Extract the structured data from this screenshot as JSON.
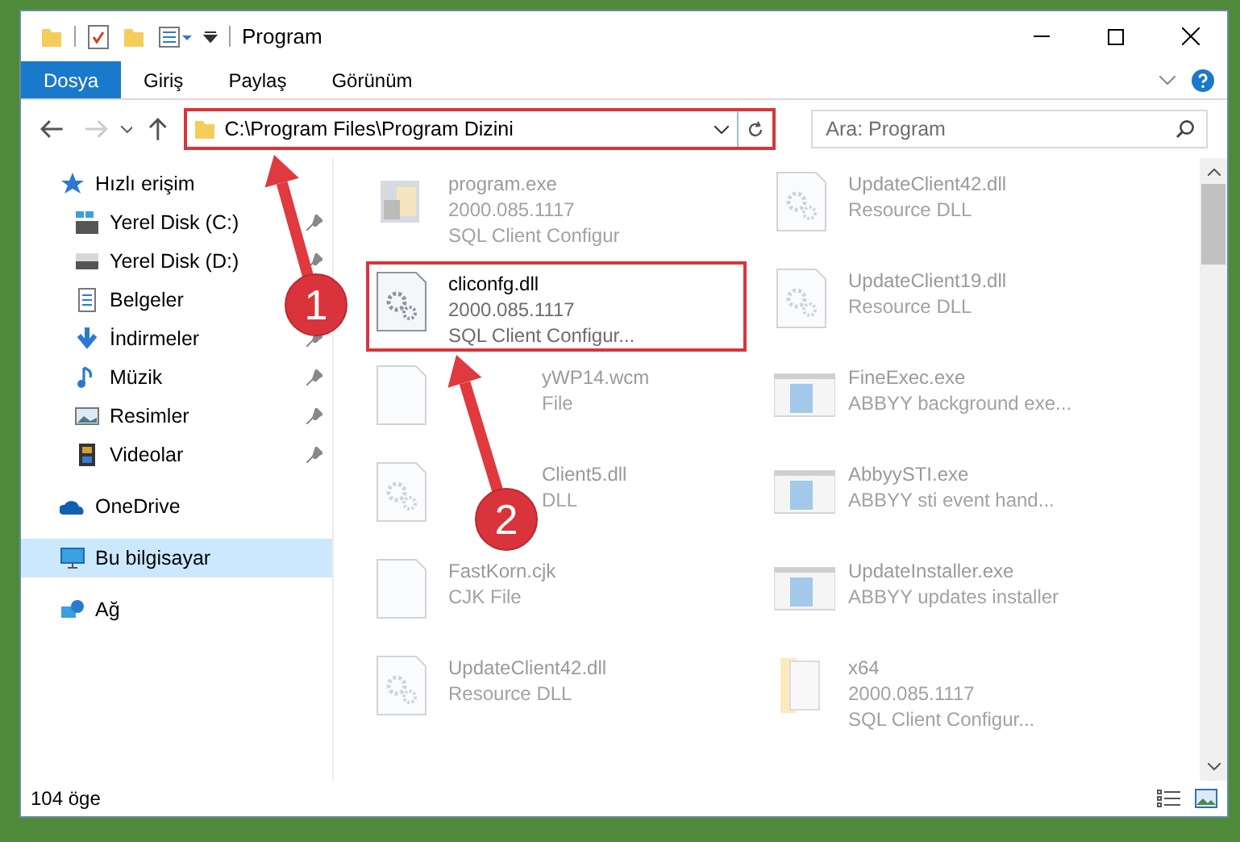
{
  "window": {
    "title": "Program"
  },
  "ribbon_tabs": [
    {
      "label": "Dosya",
      "selected": true
    },
    {
      "label": "Giriş",
      "selected": false
    },
    {
      "label": "Paylaş",
      "selected": false
    },
    {
      "label": "Görünüm",
      "selected": false
    }
  ],
  "address_bar": {
    "path": "C:\\Program Files\\Program Dizini"
  },
  "search": {
    "placeholder": "Ara: Program"
  },
  "navigation": [
    {
      "label": "Hızlı erişim",
      "kind": "star",
      "selected": false,
      "children": [
        {
          "label": "Yerel Disk (C:)",
          "kind": "drive-c",
          "pinned": true,
          "selected": false
        },
        {
          "label": "Yerel Disk (D:)",
          "kind": "drive",
          "pinned": true,
          "selected": false
        },
        {
          "label": "Belgeler",
          "kind": "docs",
          "selected": false
        },
        {
          "label": "İndirmeler",
          "kind": "download",
          "pinned": true,
          "selected": false
        },
        {
          "label": "Müzik",
          "kind": "music",
          "pinned": true,
          "selected": false
        },
        {
          "label": "Resimler",
          "kind": "pictures",
          "pinned": true,
          "selected": false
        },
        {
          "label": "Videolar",
          "kind": "video",
          "pinned": true,
          "selected": false
        }
      ]
    },
    {
      "label": "OneDrive",
      "kind": "cloud",
      "selected": false
    },
    {
      "label": "Bu bilgisayar",
      "kind": "pc",
      "selected": true
    },
    {
      "label": "Ağ",
      "kind": "network",
      "selected": false
    }
  ],
  "files": [
    {
      "name": "program.exe",
      "details": [
        "2000.085.1117",
        "SQL Client Configur"
      ],
      "kind": "exe",
      "dimmed": true,
      "highlighted": false
    },
    {
      "name": "UpdateClient42.dll",
      "details": [
        "Resource DLL"
      ],
      "kind": "dll",
      "dimmed": true,
      "highlighted": false
    },
    {
      "name": "cliconfg.dll",
      "details": [
        "2000.085.1117",
        "SQL Client Configur..."
      ],
      "kind": "dll",
      "dimmed": false,
      "highlighted": true
    },
    {
      "name": "UpdateClient19.dll",
      "details": [
        "Resource DLL"
      ],
      "kind": "dll",
      "dimmed": true,
      "highlighted": false
    },
    {
      "name": "yWP14.wcm",
      "details": [
        "File"
      ],
      "kind": "blank",
      "dimmed": true,
      "highlighted": false,
      "covered": true
    },
    {
      "name": "FineExec.exe",
      "details": [
        "ABBYY background exe..."
      ],
      "kind": "app",
      "dimmed": true,
      "highlighted": false
    },
    {
      "name": "Client5.dll",
      "details": [
        "DLL"
      ],
      "kind": "dll",
      "dimmed": true,
      "highlighted": false,
      "covered": true
    },
    {
      "name": "AbbyySTI.exe",
      "details": [
        "ABBYY sti event hand..."
      ],
      "kind": "app",
      "dimmed": true,
      "highlighted": false
    },
    {
      "name": "FastKorn.cjk",
      "details": [
        "CJK File"
      ],
      "kind": "blank",
      "dimmed": true,
      "highlighted": false
    },
    {
      "name": "UpdateInstaller.exe",
      "details": [
        "ABBYY updates installer"
      ],
      "kind": "app",
      "dimmed": true,
      "highlighted": false
    },
    {
      "name": "UpdateClient42.dll",
      "details": [
        "Resource DLL"
      ],
      "kind": "dll",
      "dimmed": true,
      "highlighted": false
    },
    {
      "name": "x64",
      "details": [
        "2000.085.1117",
        "SQL Client Configur..."
      ],
      "kind": "folder",
      "dimmed": true,
      "highlighted": false
    }
  ],
  "status_bar": {
    "count": "104 öge"
  },
  "callouts": [
    {
      "label": "1"
    },
    {
      "label": "2"
    }
  ]
}
